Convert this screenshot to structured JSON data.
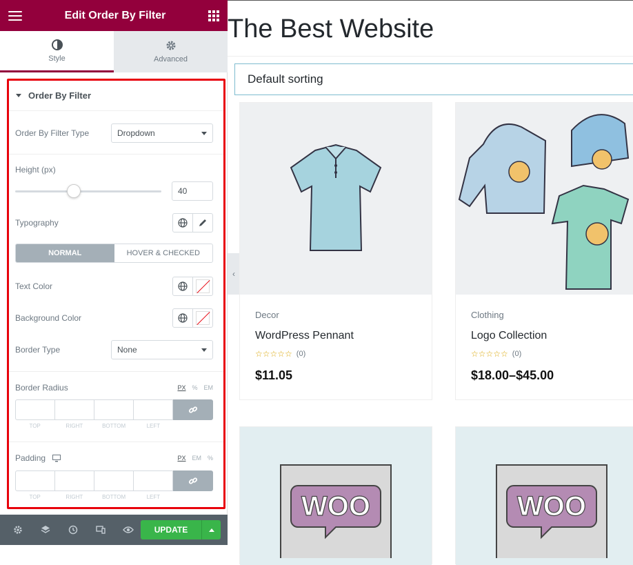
{
  "panel": {
    "title": "Edit Order By Filter",
    "tabs": [
      {
        "label": "Style",
        "icon": "contrast-icon"
      },
      {
        "label": "Advanced",
        "icon": "gear-icon"
      }
    ],
    "section_title": "Order By Filter",
    "filter_type": {
      "label": "Order By Filter Type",
      "value": "Dropdown"
    },
    "height": {
      "label": "Height (px)",
      "value": "40",
      "slider_fraction": 0.4
    },
    "typography": {
      "label": "Typography"
    },
    "state_tabs": {
      "normal": "NORMAL",
      "hover": "HOVER & CHECKED"
    },
    "text_color": {
      "label": "Text Color"
    },
    "bg_color": {
      "label": "Background Color"
    },
    "border_type": {
      "label": "Border Type",
      "value": "None"
    },
    "border_radius": {
      "label": "Border Radius",
      "units": [
        "PX",
        "%",
        "EM"
      ]
    },
    "padding": {
      "label": "Padding",
      "units": [
        "PX",
        "EM",
        "%"
      ]
    },
    "dim_labels": [
      "TOP",
      "RIGHT",
      "BOTTOM",
      "LEFT"
    ],
    "update_label": "UPDATE"
  },
  "preview": {
    "site_title": "The Best Website",
    "sorting": "Default sorting",
    "products": [
      {
        "category": "Decor",
        "name": "WordPress Pennant",
        "rating_count": "(0)",
        "price": "$11.05"
      },
      {
        "category": "Clothing",
        "name": "Logo Collection",
        "rating_count": "(0)",
        "price": "$18.00–$45.00"
      }
    ],
    "woo_text": "WOO"
  },
  "colors": {
    "brand": "#93003c",
    "highlight_border": "#e8000b",
    "update": "#39b54a"
  }
}
